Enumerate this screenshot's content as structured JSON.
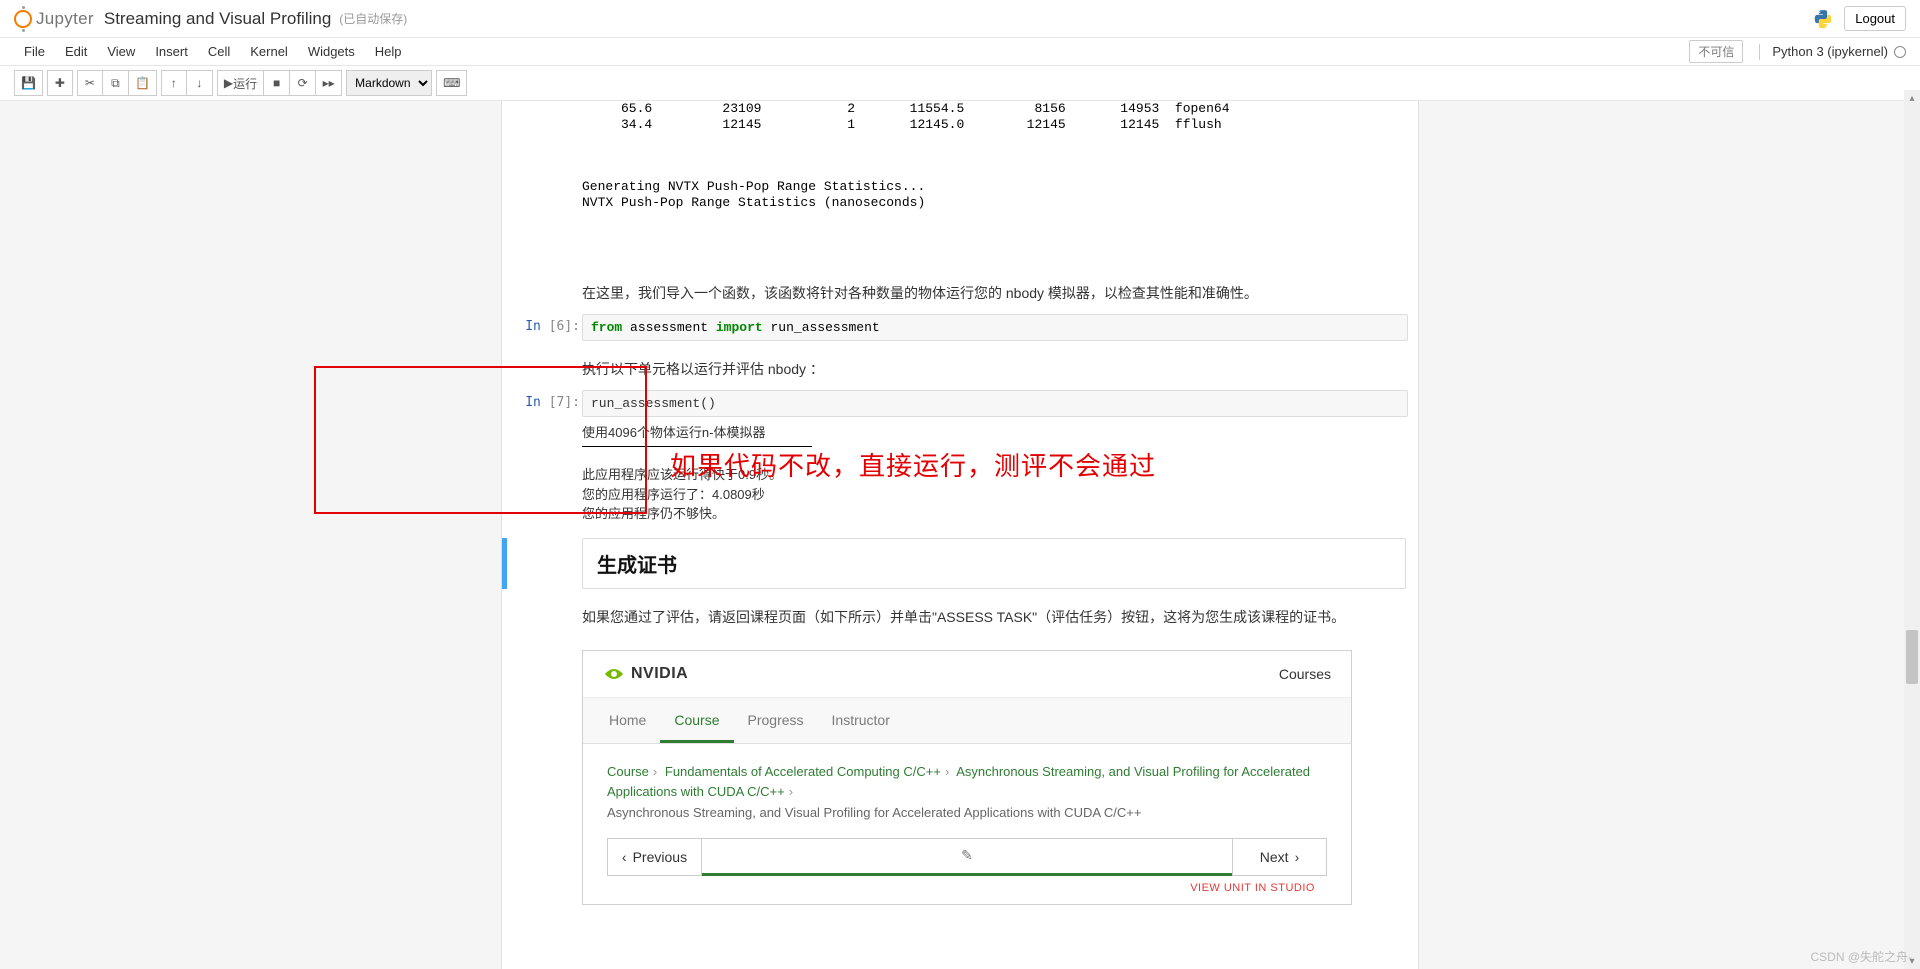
{
  "header": {
    "brand": "Jupyter",
    "title": "Streaming and Visual Profiling",
    "autosave": "(已自动保存)",
    "logout": "Logout"
  },
  "menu": {
    "file": "File",
    "edit": "Edit",
    "view": "View",
    "insert": "Insert",
    "cell": "Cell",
    "kernel": "Kernel",
    "widgets": "Widgets",
    "help": "Help",
    "not_trusted": "不可信",
    "kernel_name": "Python 3 (ipykernel)"
  },
  "toolbar": {
    "run_label": "运行",
    "cell_type": "Markdown"
  },
  "output_top": {
    "row1": "     65.6         23109           2       11554.5         8156       14953  fopen64",
    "row2": "     34.4         12145           1       12145.0        12145       12145  fflush",
    "gap": " ",
    "stat1": "Generating NVTX Push-Pop Range Statistics...",
    "stat2": "NVTX Push-Pop Range Statistics (nanoseconds)"
  },
  "md1": "在这里，我们导入一个函数，该函数将针对各种数量的物体运行您的 nbody 模拟器，以检查其性能和准确性。",
  "cell6": {
    "prompt": "In [6]:",
    "kw1": "from",
    "mod": "assessment",
    "kw2": "import",
    "fn": "run_assessment"
  },
  "md2": "执行以下单元格以运行并评估 nbody ：",
  "cell7": {
    "prompt": "In [7]:",
    "code": "run_assessment()",
    "out1": "使用4096个物体运行n-体模拟器",
    "out2": "此应用程序应该运行得快于0.9秒。",
    "out3": "您的应用程序运行了：4.0809秒",
    "out4": "您的应用程序仍不够快。"
  },
  "red_annotation": "如果代码不改，直接运行，测评不会通过",
  "heading": "生成证书",
  "md3": "如果您通过了评估，请返回课程页面（如下所示）并单击\"ASSESS TASK\"（评估任务）按钮，这将为您生成该课程的证书。",
  "nvidia": {
    "brand": "NVIDIA",
    "courses": "Courses",
    "tabs": {
      "home": "Home",
      "course": "Course",
      "progress": "Progress",
      "instructor": "Instructor"
    },
    "crumb1": "Course",
    "crumb2": "Fundamentals of Accelerated Computing C/C++",
    "crumb3": "Asynchronous Streaming, and Visual Profiling for Accelerated Applications with CUDA C/C++",
    "crumb4": "Asynchronous Streaming, and Visual Profiling for Accelerated Applications with CUDA C/C++",
    "prev": "Previous",
    "next": "Next",
    "view_unit": "VIEW UNIT IN STUDIO"
  },
  "watermark": "CSDN @失舵之舟-"
}
